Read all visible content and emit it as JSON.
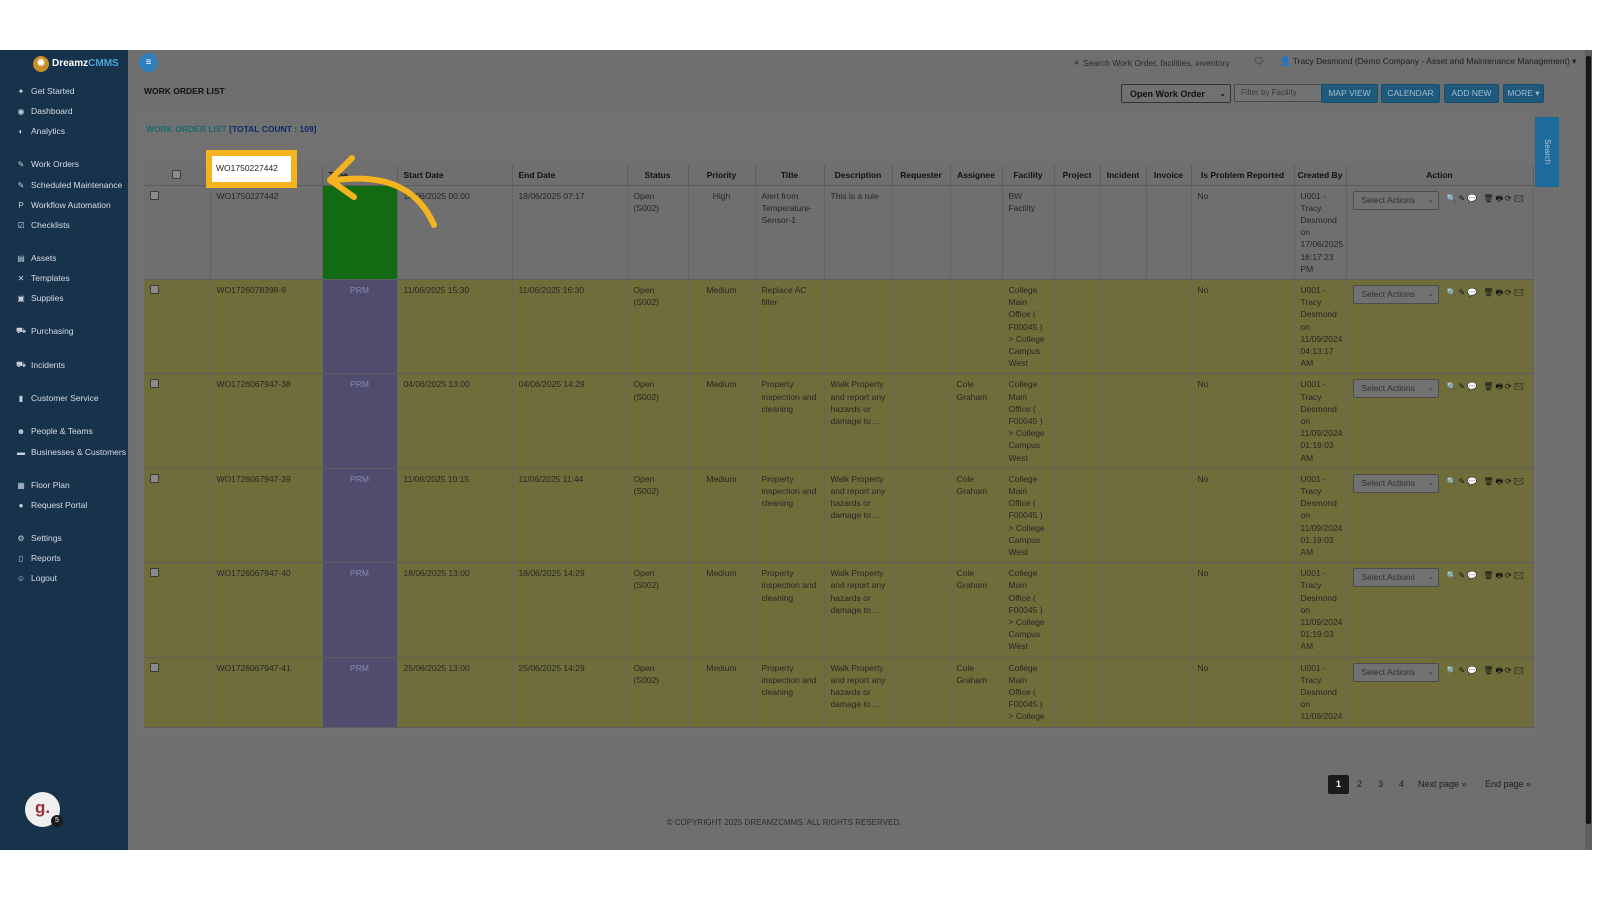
{
  "app": {
    "brand_a": "Dreamz",
    "brand_b": "CMMS",
    "search_placeholder": "Search Work Order, facilities, inventory",
    "user_label": "Tracy Desmond (Demo Company - Asset and Maintenance Management)",
    "avatar_letter": "g.",
    "avatar_badge": "5",
    "footer": "© COPYRIGHT 2025 DREAMZCMMS. ALL RIGHTS RESERVED."
  },
  "sidebar": {
    "items": [
      {
        "label": "Get Started",
        "icon": "rocket-icon",
        "glyph": "✦"
      },
      {
        "label": "Dashboard",
        "icon": "dashboard-icon",
        "glyph": "◉"
      },
      {
        "label": "Analytics",
        "icon": "analytics-icon",
        "glyph": "◐"
      },
      {
        "label": "Work Orders",
        "icon": "wrench-icon",
        "glyph": "✎"
      },
      {
        "label": "Scheduled Maintenance",
        "icon": "wrench-icon",
        "glyph": "✎"
      },
      {
        "label": "Workflow Automation",
        "icon": "workflow-icon",
        "glyph": "P"
      },
      {
        "label": "Checklists",
        "icon": "checklist-icon",
        "glyph": "☑"
      },
      {
        "label": "Assets",
        "icon": "assets-icon",
        "glyph": "▤"
      },
      {
        "label": "Templates",
        "icon": "templates-icon",
        "glyph": "✕"
      },
      {
        "label": "Supplies",
        "icon": "supplies-icon",
        "glyph": "▣"
      },
      {
        "label": "Purchasing",
        "icon": "cart-icon",
        "glyph": "⛟"
      },
      {
        "label": "Incidents",
        "icon": "incident-icon",
        "glyph": "⛟"
      },
      {
        "label": "Customer Service",
        "icon": "customer-service-icon",
        "glyph": "▮"
      },
      {
        "label": "People & Teams",
        "icon": "people-icon",
        "glyph": "☻"
      },
      {
        "label": "Businesses & Customers",
        "icon": "business-icon",
        "glyph": "▬"
      },
      {
        "label": "Floor Plan",
        "icon": "floor-plan-icon",
        "glyph": "▦"
      },
      {
        "label": "Request Portal",
        "icon": "request-portal-icon",
        "glyph": "●"
      },
      {
        "label": "Settings",
        "icon": "settings-icon",
        "glyph": "⚙"
      },
      {
        "label": "Reports",
        "icon": "reports-icon",
        "glyph": "▯"
      },
      {
        "label": "Logout",
        "icon": "logout-icon",
        "glyph": "☺"
      }
    ]
  },
  "page": {
    "title": "WORK ORDER LIST",
    "list_title": "WORK ORDER LIST",
    "total_count": "[TOTAL COUNT : 109]",
    "filter_select": "Open Work Order",
    "facility_placeholder": "Filter by Facility",
    "buttons": {
      "map_view": "MAP VIEW",
      "calendar": "CALENDAR",
      "add_new": "ADD NEW",
      "more": "MORE ▾"
    },
    "search_tab": "Search"
  },
  "table": {
    "columns": [
      "",
      "Work Order",
      "Type",
      "Start Date",
      "End Date",
      "Status",
      "Priority",
      "Title",
      "Description",
      "Requester",
      "Assignee",
      "Facility",
      "Project",
      "Incident",
      "Invoice",
      "Is Problem Reported",
      "Created By",
      "Action"
    ],
    "action_select": "Select Actions",
    "action_icons": "🔍✎💬 🗑🖶⟳✉",
    "rows": [
      {
        "wo": "WO1750227442",
        "type": "",
        "start": "18/06/2025 00:00",
        "end": "18/06/2025 07:17",
        "status": "Open (S002)",
        "priority": "High",
        "title": "Alert from Temperature-Sensor-1",
        "desc": "This is a rule",
        "requester": "",
        "assignee": "",
        "facility": "BW Facility",
        "project": "",
        "incident": "",
        "invoice": "",
        "problem": "No",
        "created": "U001 - Tracy Desmond on 17/06/2025 16:17:23 PM"
      },
      {
        "wo": "WO1726078398-9",
        "type": "PRM",
        "start": "11/06/2025 15:30",
        "end": "11/06/2025 16:30",
        "status": "Open (S002)",
        "priority": "Medium",
        "title": "Replace AC filter",
        "desc": "",
        "requester": "",
        "assignee": "",
        "facility": "College Main Office ( F00045 ) > College Campus West",
        "project": "",
        "incident": "",
        "invoice": "",
        "problem": "No",
        "created": "U001 - Tracy Desmond on 11/09/2024 04:13:17 AM"
      },
      {
        "wo": "WO1726067947-38",
        "type": "PRM",
        "start": "04/06/2025 13:00",
        "end": "04/06/2025 14:29",
        "status": "Open (S002)",
        "priority": "Medium",
        "title": "Property inspection and cleaning",
        "desc": "Walk Property and report any hazards or damage to ...",
        "requester": "",
        "assignee": "Cole Graham",
        "facility": "College Main Office ( F00045 ) > College Campus West",
        "project": "",
        "incident": "",
        "invoice": "",
        "problem": "No",
        "created": "U001 - Tracy Desmond on 11/09/2024 01:19:03 AM"
      },
      {
        "wo": "WO1726067947-39",
        "type": "PRM",
        "start": "11/06/2025 10:15",
        "end": "11/06/2025 11:44",
        "status": "Open (S002)",
        "priority": "Medium",
        "title": "Property inspection and cleaning",
        "desc": "Walk Property and report any hazards or damage to ...",
        "requester": "",
        "assignee": "Cole Graham",
        "facility": "College Main Office ( F00045 ) > College Campus West",
        "project": "",
        "incident": "",
        "invoice": "",
        "problem": "No",
        "created": "U001 - Tracy Desmond on 11/09/2024 01:19:03 AM"
      },
      {
        "wo": "WO1726067947-40",
        "type": "PRM",
        "start": "18/06/2025 13:00",
        "end": "18/06/2025 14:29",
        "status": "Open (S002)",
        "priority": "Medium",
        "title": "Property inspection and cleaning",
        "desc": "Walk Property and report any hazards or damage to ...",
        "requester": "",
        "assignee": "Cole Graham",
        "facility": "College Main Office ( F00045 ) > College Campus West",
        "project": "",
        "incident": "",
        "invoice": "",
        "problem": "No",
        "created": "U001 - Tracy Desmond on 11/09/2024 01:19:03 AM"
      },
      {
        "wo": "WO1726067947-41",
        "type": "PRM",
        "start": "25/06/2025 13:00",
        "end": "25/06/2025 14:29",
        "status": "Open (S002)",
        "priority": "Medium",
        "title": "Property inspection and cleaning",
        "desc": "Walk Property and report any hazards or damage to ...",
        "requester": "",
        "assignee": "Cole Graham",
        "facility": "College Main Office ( F00045 ) > College",
        "project": "",
        "incident": "",
        "invoice": "",
        "problem": "No",
        "created": "U001 - Tracy Desmond on 11/09/2024"
      }
    ]
  },
  "pagination": {
    "pages": [
      "1",
      "2",
      "3",
      "4"
    ],
    "active": "1",
    "next": "Next page »",
    "end": "End page »"
  },
  "highlight": {
    "label": "WO1750227442",
    "color": "#f5b320"
  }
}
